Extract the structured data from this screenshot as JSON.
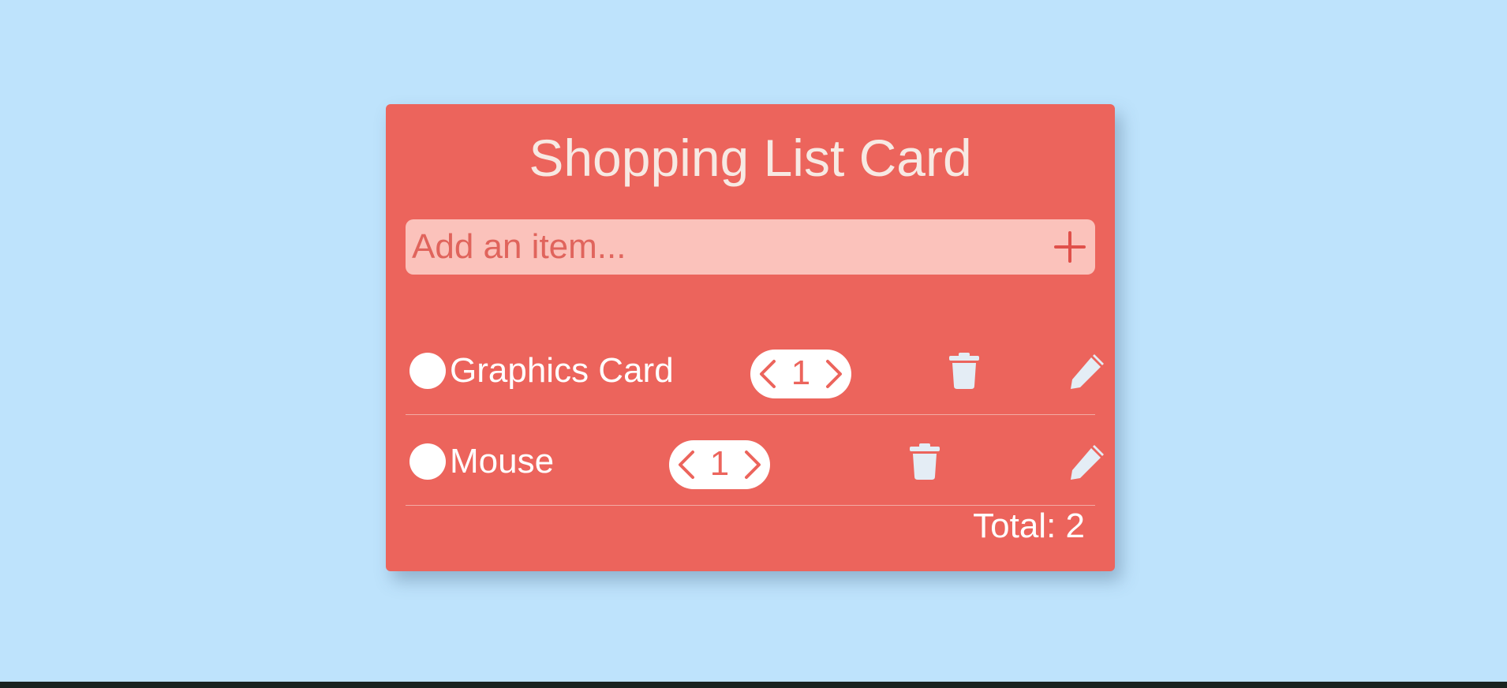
{
  "card": {
    "title": "Shopping List Card"
  },
  "add_item": {
    "placeholder": "Add an item...",
    "value": "",
    "button_icon": "plus-icon"
  },
  "items": [
    {
      "name": "Graphics Card",
      "quantity": "1",
      "checked": false
    },
    {
      "name": "Mouse",
      "quantity": "1",
      "checked": false
    }
  ],
  "footer": {
    "total_label": "Total: 2"
  },
  "icons": {
    "decrement": "chevron-left-icon",
    "increment": "chevron-right-icon",
    "delete": "trash-icon",
    "edit": "pencil-icon"
  },
  "colors": {
    "background": "#bee3fc",
    "card": "#ec645c",
    "input_background": "#fbc2bb",
    "icon_light": "#e4edf5",
    "text": "#ffffff"
  }
}
